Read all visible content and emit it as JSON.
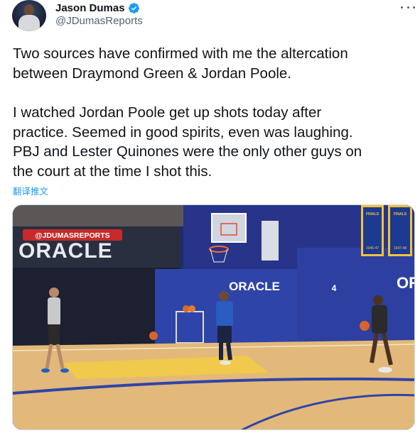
{
  "author": {
    "display_name": "Jason Dumas",
    "handle": "@JDumasReports",
    "verified": true
  },
  "tweet": {
    "paragraph1": [
      "Two sources have confirmed with me the altercation",
      "between Draymond Green & Jordan Poole."
    ],
    "paragraph2": [
      "I watched Jordan Poole get up shots today after",
      "practice. Seemed in good spirits, even was laughing.",
      "PBJ and Lester Quinones were the only other guys on",
      "the court at the time I shot this."
    ],
    "translate_label": "翻译推文"
  },
  "media": {
    "watermark": "@JDUMASREPORTS",
    "wall_logo_left": "ORACLE",
    "wall_logo_center": "ORACLE",
    "wall_logo_right": "ORA",
    "wall_number": "4",
    "banner1_top": "FINALS",
    "banner1_bottom": "1946-47",
    "banner2_top": "FINALS",
    "banner2_bottom": "1947-48"
  },
  "colors": {
    "link": "#1d9bf0",
    "verified": "#1d9bf0",
    "secondary_text": "#536471",
    "wall_blue": "#2f44a8",
    "floor": "#e2b97a"
  },
  "icons": {
    "verified": "verified-badge-icon",
    "more": "more-options-icon"
  }
}
